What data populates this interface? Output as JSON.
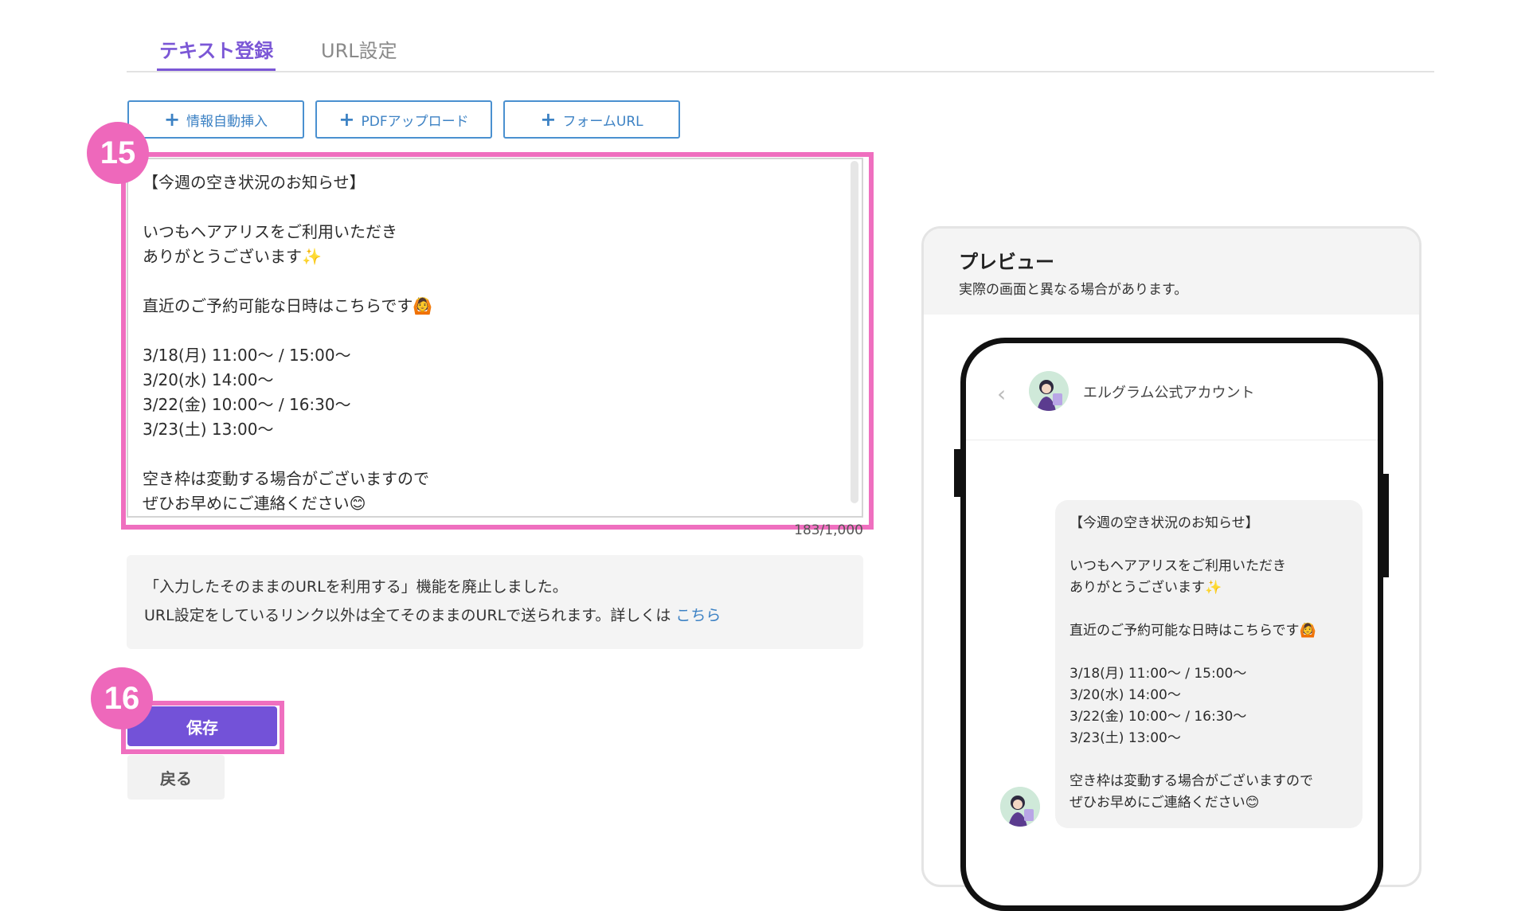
{
  "tabs": [
    {
      "label": "テキスト登録",
      "active": true
    },
    {
      "label": "URL設定",
      "active": false
    }
  ],
  "insert_buttons": [
    {
      "label": "情報自動挿入"
    },
    {
      "label": "PDFアップロード"
    },
    {
      "label": "フォームURL"
    }
  ],
  "annotations": {
    "badge_text": "15",
    "badge_save": "16"
  },
  "editor": {
    "text": "【今週の空き状況のお知らせ】\n\nいつもヘアアリスをご利用いただき\nありがとうございます✨\n\n直近のご予約可能な日時はこちらです🙆\n\n3/18(月) 11:00〜 / 15:00〜\n3/20(水) 14:00〜\n3/22(金) 10:00〜 / 16:30〜\n3/23(土) 13:00〜\n\n空き枠は変動する場合がございますので\nぜひお早めにご連絡ください😊",
    "counter": "183/1,000"
  },
  "notice": {
    "line1": "「入力したそのままのURLを利用する」機能を廃止しました。",
    "line2": "URL設定をしているリンク以外は全てそのままのURLで送られます。詳しくは",
    "link": "こちら"
  },
  "actions": {
    "save": "保存",
    "back": "戻る"
  },
  "preview": {
    "title": "プレビュー",
    "subtitle": "実際の画面と異なる場合があります。",
    "account_name": "エルグラム公式アカウント",
    "back_icon": "chevron-left-icon",
    "message": "【今週の空き状況のお知らせ】\n\nいつもヘアアリスをご利用いただき\nありがとうございます✨\n\n直近のご予約可能な日時はこちらです🙆\n\n3/18(月) 11:00〜 / 15:00〜\n3/20(水) 14:00〜\n3/22(金) 10:00〜 / 16:30〜\n3/23(土) 13:00〜\n\n空き枠は変動する場合がございますので\nぜひお早めにご連絡ください😊"
  },
  "colors": {
    "accent": "#7352d8",
    "link": "#3d82c4",
    "highlight": "#ef6fbf"
  }
}
